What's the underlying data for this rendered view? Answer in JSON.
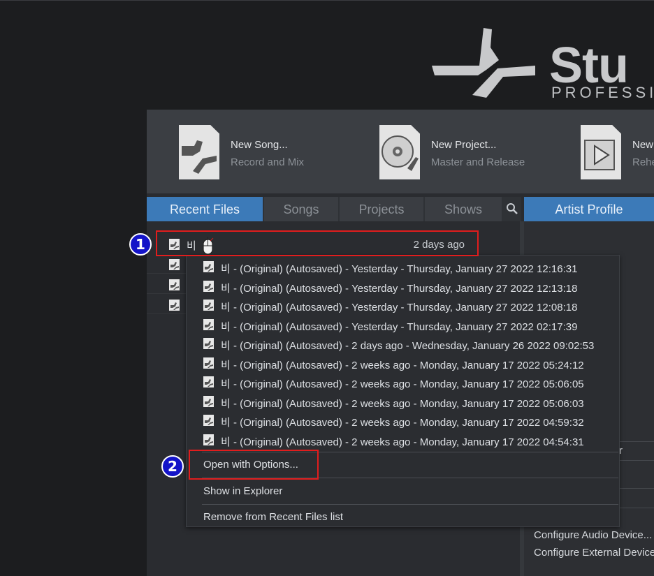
{
  "logo": {
    "word": "Stu",
    "sub": "PROFESSIO"
  },
  "quick_actions": [
    {
      "title": "New Song...",
      "subtitle": "Record and Mix",
      "icon": "song-icon"
    },
    {
      "title": "New Project...",
      "subtitle": "Master and Release",
      "icon": "project-disc-icon"
    },
    {
      "title": "New",
      "subtitle": "Rehe",
      "icon": "show-play-icon"
    }
  ],
  "tabs": {
    "recent": "Recent Files",
    "songs": "Songs",
    "projects": "Projects",
    "shows": "Shows",
    "artist": "Artist Profile"
  },
  "recent_files": [
    {
      "name": "비",
      "date": "2 days ago"
    }
  ],
  "context_menu": {
    "versions": [
      "비 - (Original) (Autosaved) - Yesterday - Thursday, January 27 2022 12:16:31",
      "비 - (Original) (Autosaved) - Yesterday - Thursday, January 27 2022 12:13:18",
      "비 - (Original) (Autosaved) - Yesterday - Thursday, January 27 2022 12:08:18",
      "비 - (Original) (Autosaved) - Yesterday - Thursday, January 27 2022 02:17:39",
      "비 - (Original) (Autosaved) - 2 days ago - Wednesday, January 26 2022 09:02:53",
      "비 - (Original) (Autosaved) - 2 weeks ago - Monday, January 17 2022 05:24:12",
      "비 - (Original) (Autosaved) - 2 weeks ago - Monday, January 17 2022 05:06:05",
      "비 - (Original) (Autosaved) - 2 weeks ago - Monday, January 17 2022 05:06:03",
      "비 - (Original) (Autosaved) - 2 weeks ago - Monday, January 17 2022 04:59:32",
      "비 - (Original) (Autosaved) - 2 weeks ago - Monday, January 17 2022 04:54:31"
    ],
    "open_with_options": "Open with Options...",
    "show_in_explorer": "Show in Explorer",
    "remove": "Remove from Recent Files list"
  },
  "right_pane": {
    "partial_label": "r",
    "configure_audio": "Configure Audio Device...",
    "configure_external": "Configure External Device"
  },
  "annotations": {
    "step1": "1",
    "step2": "2"
  },
  "colors": {
    "accent": "#3c7ab8",
    "highlight": "#e11d1d",
    "badge": "#1414c8"
  }
}
